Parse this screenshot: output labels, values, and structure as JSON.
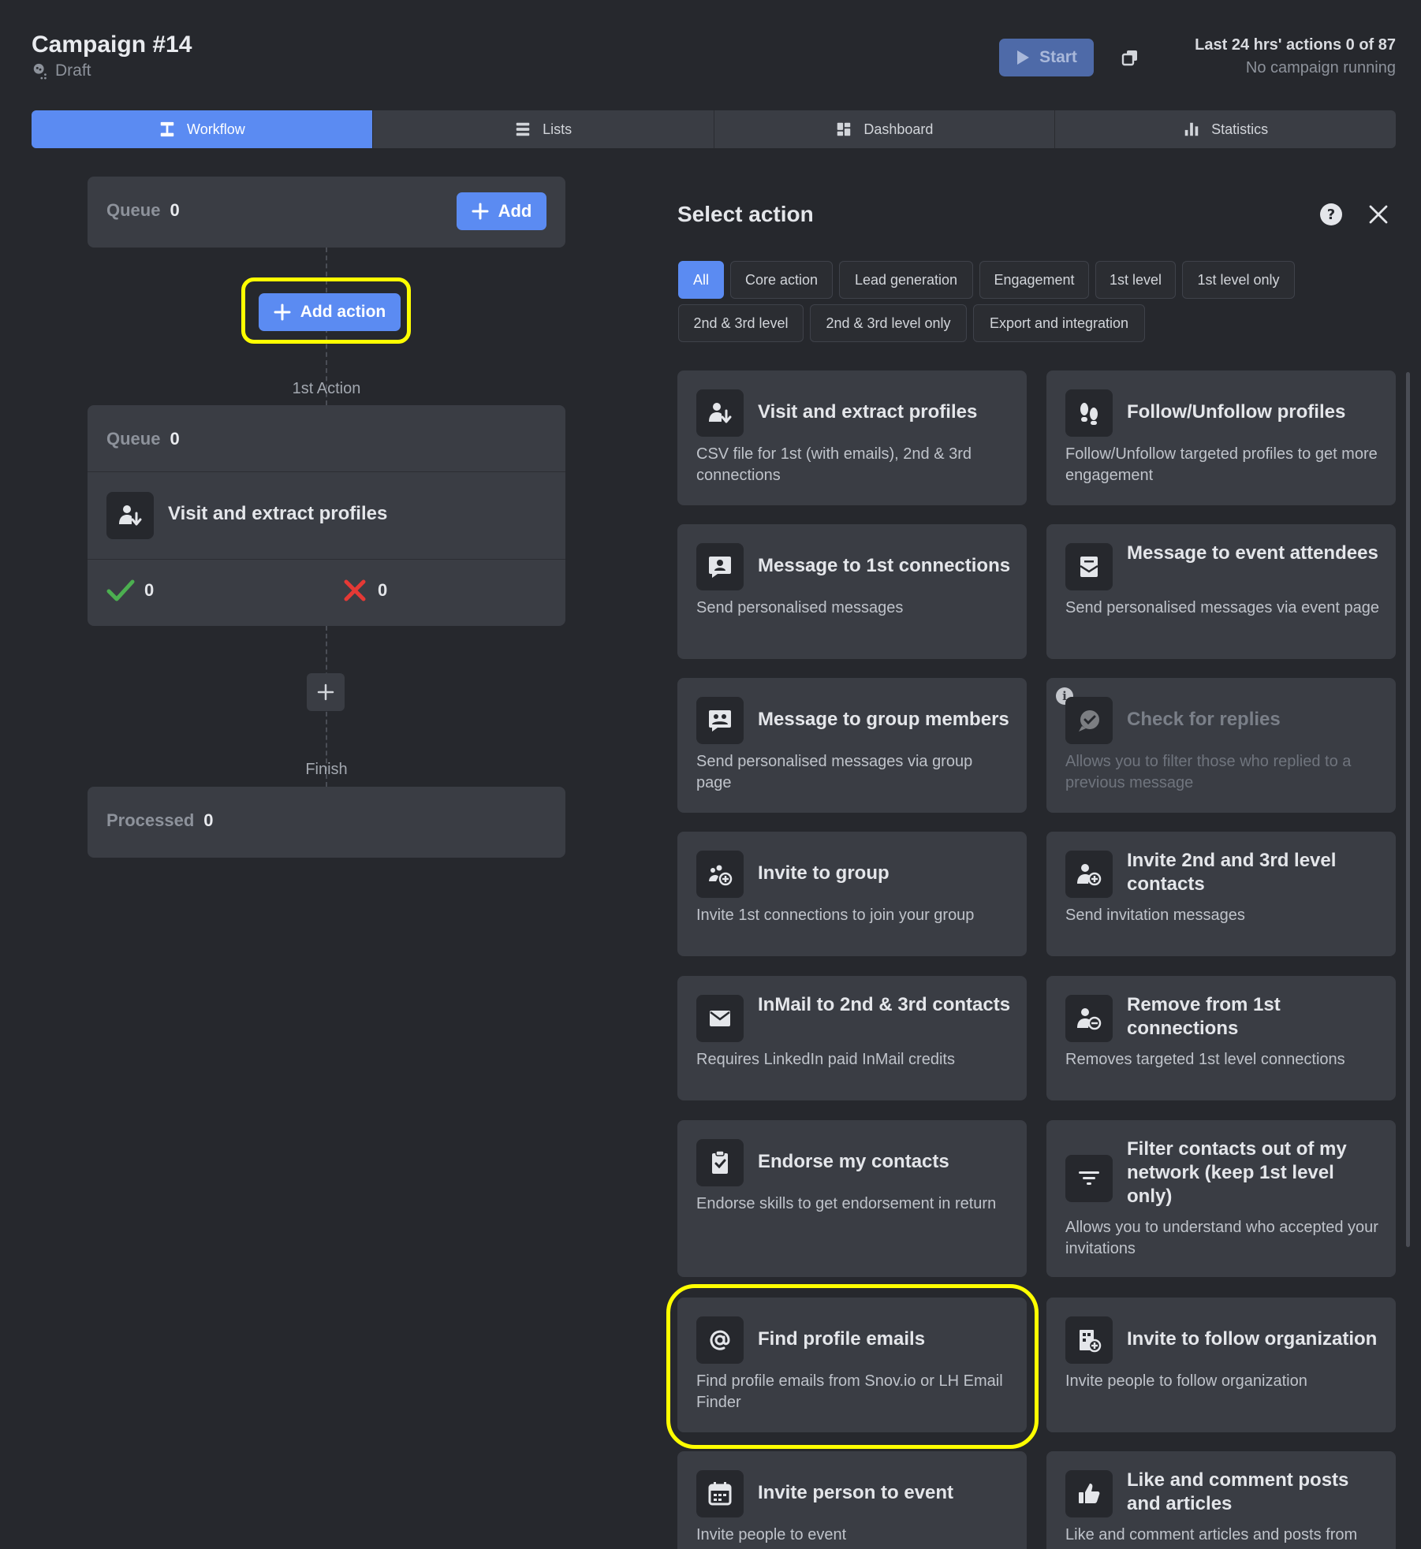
{
  "header": {
    "title": "Campaign #14",
    "status": "Draft",
    "start_label": "Start",
    "limits_line1": "Last 24 hrs' actions 0 of 87",
    "limits_line2": "No campaign running"
  },
  "tabs": [
    {
      "label": "Workflow",
      "icon": "workflow-icon",
      "active": true
    },
    {
      "label": "Lists",
      "icon": "list-icon"
    },
    {
      "label": "Dashboard",
      "icon": "dashboard-icon"
    },
    {
      "label": "Statistics",
      "icon": "bar-chart-icon"
    }
  ],
  "workflow": {
    "queue_label": "Queue",
    "queue_value": "0",
    "add_label": "Add",
    "add_action_label": "Add action",
    "step1_label": "1st Action",
    "step1_queue_label": "Queue",
    "step1_queue_value": "0",
    "step1_action": "Visit and extract profiles",
    "success_count": "0",
    "fail_count": "0",
    "finish_label": "Finish",
    "processed_label": "Processed",
    "processed_value": "0"
  },
  "select_action": {
    "title": "Select action",
    "filters": [
      "All",
      "Core action",
      "Lead generation",
      "Engagement",
      "1st level",
      "1st level only",
      "2nd & 3rd level",
      "2nd & 3rd level only",
      "Export and integration"
    ],
    "active_filter": "All",
    "actions": [
      {
        "title": "Visit and extract profiles",
        "desc": "CSV file for 1st (with emails), 2nd & 3rd connections",
        "icon": "person-download-icon"
      },
      {
        "title": "Follow/Unfollow profiles",
        "desc": "Follow/Unfollow targeted profiles to get more engagement",
        "icon": "footprints-icon"
      },
      {
        "title": "Message to 1st connections",
        "desc": "Send personalised messages",
        "icon": "chat-person-icon"
      },
      {
        "title": "Message to event attendees",
        "desc": "Send personalised messages via event page",
        "icon": "envelope-open-icon"
      },
      {
        "title": "Message to group members",
        "desc": "Send personalised messages via group page",
        "icon": "chat-group-icon"
      },
      {
        "title": "Check for replies",
        "desc": "Allows you to filter those who replied to a previous message",
        "icon": "chat-check-icon",
        "disabled": true
      },
      {
        "title": "Invite to group",
        "desc": "Invite 1st connections to join your group",
        "icon": "group-add-icon"
      },
      {
        "title": "Invite 2nd and 3rd level contacts",
        "desc": "Send invitation messages",
        "icon": "person-add-icon"
      },
      {
        "title": "InMail to 2nd & 3rd contacts",
        "desc": "Requires LinkedIn paid InMail credits",
        "icon": "mail-icon"
      },
      {
        "title": "Remove from 1st connections",
        "desc": "Removes targeted 1st level connections",
        "icon": "person-remove-icon"
      },
      {
        "title": "Endorse my contacts",
        "desc": "Endorse skills to get endorsement in return",
        "icon": "clipboard-check-icon"
      },
      {
        "title": "Filter contacts out of my network (keep 1st level only)",
        "desc": "Allows you to understand who accepted your invitations",
        "icon": "filter-icon"
      },
      {
        "title": "Find profile emails",
        "desc": "Find profile emails from Snov.io or LH Email Finder",
        "icon": "at-sign-icon"
      },
      {
        "title": "Invite to follow organization",
        "desc": "Invite people to follow organization",
        "icon": "building-add-icon"
      },
      {
        "title": "Invite person to event",
        "desc": "Invite people to event",
        "icon": "calendar-icon"
      },
      {
        "title": "Like and comment posts and articles",
        "desc": "Like and comment articles and posts from",
        "icon": "thumbs-up-icon"
      }
    ]
  },
  "colors": {
    "background": "#26282d",
    "card": "#3a3d44",
    "accent": "#5b8bf2",
    "highlight": "#ffff00",
    "success": "#4caf50",
    "fail": "#e53935"
  }
}
